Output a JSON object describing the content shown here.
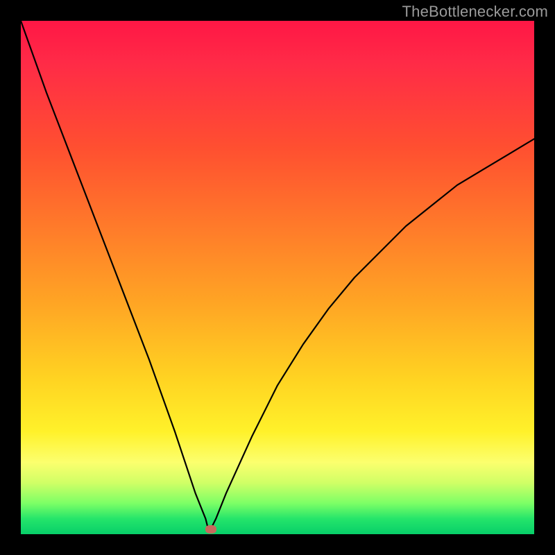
{
  "attribution": "TheBottlenecker.com",
  "chart_data": {
    "type": "line",
    "title": "",
    "xlabel": "",
    "ylabel": "",
    "xlim": [
      0,
      100
    ],
    "ylim": [
      0,
      100
    ],
    "series": [
      {
        "name": "bottleneck-curve",
        "x": [
          0,
          5,
          10,
          15,
          20,
          25,
          30,
          32,
          34,
          36,
          36.5,
          37,
          38,
          40,
          45,
          50,
          55,
          60,
          65,
          70,
          75,
          80,
          85,
          90,
          95,
          100
        ],
        "values": [
          100,
          86,
          73,
          60,
          47,
          34,
          20,
          14,
          8,
          3,
          1,
          1,
          3,
          8,
          19,
          29,
          37,
          44,
          50,
          55,
          60,
          64,
          68,
          71,
          74,
          77
        ]
      }
    ],
    "marker": {
      "x": 37,
      "y": 1
    },
    "gradient_stops": [
      {
        "pct": 0,
        "color": "#ff1745"
      },
      {
        "pct": 25,
        "color": "#ff5030"
      },
      {
        "pct": 55,
        "color": "#ffa524"
      },
      {
        "pct": 80,
        "color": "#fff12a"
      },
      {
        "pct": 94,
        "color": "#7cff66"
      },
      {
        "pct": 100,
        "color": "#07cf69"
      }
    ]
  }
}
